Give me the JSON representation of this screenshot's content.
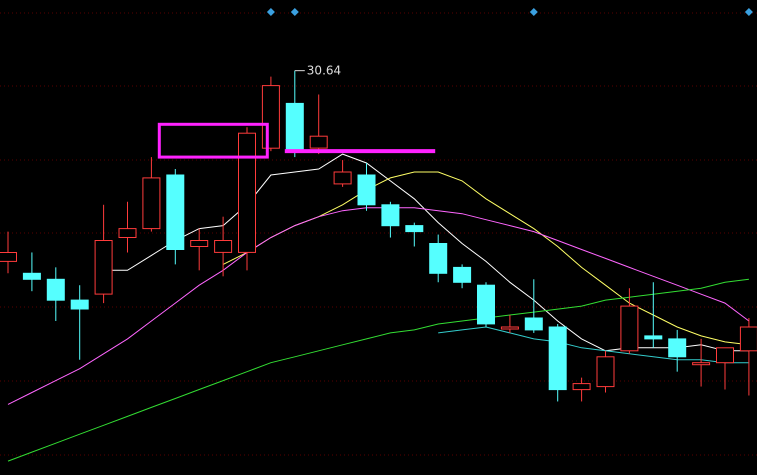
{
  "chart_data": {
    "type": "candlestick",
    "title": "",
    "price_range": [
      17.2,
      32.3
    ],
    "grid": "dotted-horizontal",
    "high_label": "30.64",
    "colors": {
      "background": "#000000",
      "up": "#ff3b3b",
      "down": "#55ffff",
      "grid": "#5a0000",
      "annotation": "#ff22ff",
      "label": "#dddddd",
      "marker": "#3aa0e0",
      "ma5": "#ffffff",
      "ma10": "#ffff66",
      "ma20": "#ff66ff",
      "ma60": "#33dd33",
      "ma120": "#33cccc"
    },
    "candles": [
      {
        "o": 24.2,
        "h": 25.2,
        "l": 23.8,
        "c": 24.5
      },
      {
        "o": 23.8,
        "h": 24.5,
        "l": 23.2,
        "c": 23.6
      },
      {
        "o": 23.6,
        "h": 24.0,
        "l": 22.2,
        "c": 22.9
      },
      {
        "o": 22.9,
        "h": 23.4,
        "l": 20.9,
        "c": 22.6
      },
      {
        "o": 23.1,
        "h": 26.1,
        "l": 22.8,
        "c": 24.9
      },
      {
        "o": 25.0,
        "h": 26.2,
        "l": 24.5,
        "c": 25.3
      },
      {
        "o": 25.3,
        "h": 27.7,
        "l": 25.2,
        "c": 27.0
      },
      {
        "o": 27.1,
        "h": 27.3,
        "l": 24.1,
        "c": 24.6
      },
      {
        "o": 24.7,
        "h": 25.3,
        "l": 23.9,
        "c": 24.9
      },
      {
        "o": 24.5,
        "h": 25.7,
        "l": 23.7,
        "c": 24.9
      },
      {
        "o": 24.5,
        "h": 28.7,
        "l": 23.9,
        "c": 28.5
      },
      {
        "o": 28.0,
        "h": 30.4,
        "l": 27.9,
        "c": 30.1
      },
      {
        "o": 29.5,
        "h": 30.6,
        "l": 27.7,
        "c": 27.9
      },
      {
        "o": 28.0,
        "h": 29.8,
        "l": 27.8,
        "c": 28.4
      },
      {
        "o": 26.8,
        "h": 27.6,
        "l": 26.7,
        "c": 27.2
      },
      {
        "o": 27.1,
        "h": 27.5,
        "l": 25.9,
        "c": 26.1
      },
      {
        "o": 26.1,
        "h": 26.2,
        "l": 25.0,
        "c": 25.4
      },
      {
        "o": 25.4,
        "h": 25.5,
        "l": 24.7,
        "c": 25.2
      },
      {
        "o": 24.8,
        "h": 25.1,
        "l": 23.5,
        "c": 23.8
      },
      {
        "o": 24.0,
        "h": 24.1,
        "l": 23.3,
        "c": 23.5
      },
      {
        "o": 23.4,
        "h": 23.5,
        "l": 22.0,
        "c": 22.1
      },
      {
        "o": 22.0,
        "h": 22.4,
        "l": 21.8,
        "c": 22.0
      },
      {
        "o": 22.3,
        "h": 23.6,
        "l": 21.8,
        "c": 21.9
      },
      {
        "o": 22.0,
        "h": 22.1,
        "l": 19.5,
        "c": 19.9
      },
      {
        "o": 19.9,
        "h": 20.3,
        "l": 19.5,
        "c": 20.1
      },
      {
        "o": 20.0,
        "h": 21.2,
        "l": 19.8,
        "c": 21.0
      },
      {
        "o": 21.2,
        "h": 23.3,
        "l": 21.1,
        "c": 22.7
      },
      {
        "o": 21.7,
        "h": 23.5,
        "l": 21.3,
        "c": 21.6
      },
      {
        "o": 21.6,
        "h": 21.9,
        "l": 20.5,
        "c": 21.0
      },
      {
        "o": 20.8,
        "h": 21.6,
        "l": 20.0,
        "c": 20.8
      },
      {
        "o": 20.8,
        "h": 21.1,
        "l": 19.9,
        "c": 21.3
      },
      {
        "o": 21.2,
        "h": 22.3,
        "l": 19.7,
        "c": 22.0
      }
    ],
    "moving_averages": [
      {
        "id": "ma5",
        "values": [
          null,
          null,
          null,
          null,
          23.9,
          23.9,
          24.4,
          24.9,
          25.3,
          25.4,
          26.1,
          27.1,
          27.2,
          27.3,
          27.8,
          27.5,
          26.9,
          26.3,
          25.5,
          24.8,
          24.2,
          23.5,
          22.9,
          22.2,
          21.6,
          21.2,
          21.3,
          21.3,
          21.3,
          21.4,
          21.2,
          21.2
        ]
      },
      {
        "id": "ma10",
        "values": [
          null,
          null,
          null,
          null,
          null,
          null,
          null,
          null,
          null,
          24.1,
          24.5,
          25.0,
          25.4,
          25.7,
          26.1,
          26.6,
          27.0,
          27.2,
          27.2,
          26.9,
          26.3,
          25.8,
          25.3,
          24.7,
          24.0,
          23.4,
          22.8,
          22.4,
          22.0,
          21.7,
          21.5,
          21.4
        ]
      },
      {
        "id": "ma20",
        "values": [
          19.4,
          19.8,
          20.2,
          20.6,
          21.1,
          21.6,
          22.2,
          22.8,
          23.4,
          23.9,
          24.5,
          25.0,
          25.4,
          25.7,
          25.9,
          26.0,
          26.0,
          26.0,
          25.9,
          25.8,
          25.6,
          25.4,
          25.2,
          24.9,
          24.6,
          24.3,
          24.0,
          23.7,
          23.4,
          23.1,
          22.8,
          22.2
        ]
      },
      {
        "id": "ma60",
        "values": [
          17.5,
          17.8,
          18.1,
          18.4,
          18.7,
          19.0,
          19.3,
          19.6,
          19.9,
          20.2,
          20.5,
          20.8,
          21.0,
          21.2,
          21.4,
          21.6,
          21.8,
          21.9,
          22.1,
          22.2,
          22.3,
          22.4,
          22.5,
          22.6,
          22.7,
          22.9,
          23.0,
          23.1,
          23.2,
          23.3,
          23.5,
          23.6
        ]
      },
      {
        "id": "ma120",
        "values": [
          null,
          null,
          null,
          null,
          null,
          null,
          null,
          null,
          null,
          null,
          null,
          null,
          null,
          null,
          null,
          null,
          null,
          null,
          21.8,
          21.9,
          22.0,
          21.8,
          21.6,
          21.5,
          21.3,
          21.2,
          21.1,
          21.0,
          20.9,
          20.9,
          20.8,
          20.8
        ]
      }
    ],
    "markers_top": [
      11,
      12,
      22,
      31
    ]
  }
}
